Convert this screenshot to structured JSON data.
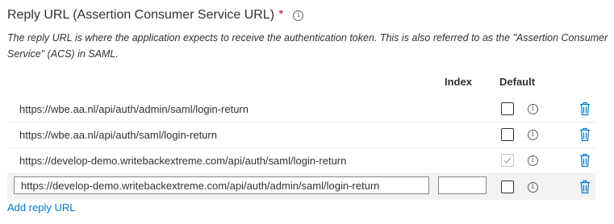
{
  "section": {
    "title": "Reply URL (Assertion Consumer Service URL)",
    "required_marker": "*",
    "info_glyph": "i",
    "description": "The reply URL is where the application expects to receive the authentication token. This is also referred to as the \"Assertion Consumer Service\" (ACS) in SAML."
  },
  "table": {
    "headers": {
      "index": "Index",
      "default": "Default"
    },
    "rows": [
      {
        "url": "https://wbe.aa.nl/api/auth/admin/saml/login-return",
        "index": "",
        "default": false
      },
      {
        "url": "https://wbe.aa.nl/api/auth/saml/login-return",
        "index": "",
        "default": false
      },
      {
        "url": "https://develop-demo.writebackextreme.com/api/auth/saml/login-return",
        "index": "",
        "default": true
      },
      {
        "url": "https://develop-demo.writebackextreme.com/api/auth/admin/saml/login-return",
        "index": "",
        "default": false,
        "editing": true
      }
    ]
  },
  "add_link": "Add reply URL",
  "icons": {
    "info": "info-icon",
    "delete": "trash-icon",
    "check": "checkmark-icon"
  },
  "colors": {
    "accent": "#0078d4",
    "required": "#a4262c",
    "row_edit_bg": "#f3f2f1"
  }
}
